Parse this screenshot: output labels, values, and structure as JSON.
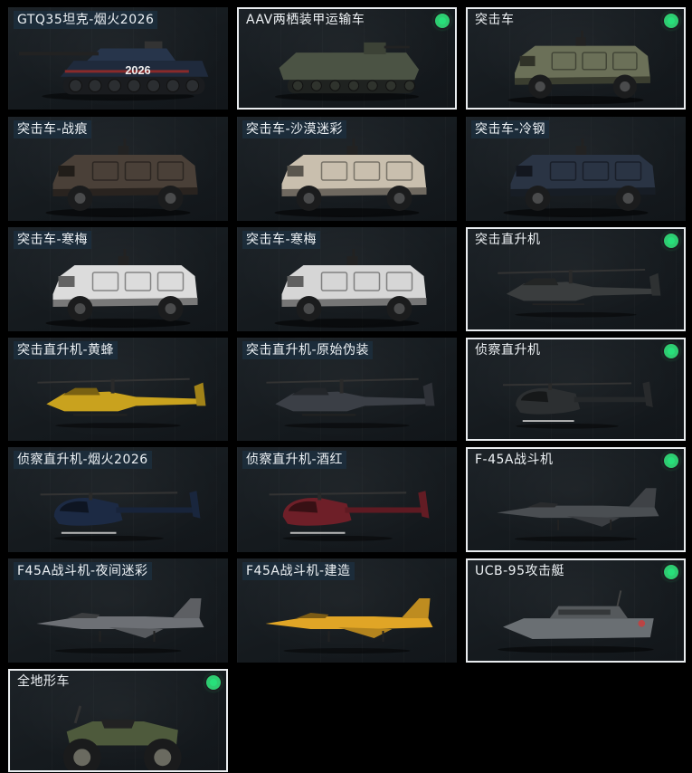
{
  "vehicles": [
    {
      "label": "GTQ35坦克-烟火2026",
      "icon": "tank-icon",
      "selected": false,
      "hull": "#1f2a3c",
      "trim": "#8a2a2a",
      "decal": "2026"
    },
    {
      "label": "AAV两栖装甲运输车",
      "icon": "amphibious-apc-icon",
      "selected": true,
      "hull": "#4b5344"
    },
    {
      "label": "突击车",
      "icon": "armored-car-icon",
      "selected": true,
      "hull": "#6b7058"
    },
    {
      "label": "突击车-战痕",
      "icon": "armored-car-icon",
      "selected": false,
      "hull": "#4a4038"
    },
    {
      "label": "突击车-沙漠迷彩",
      "icon": "armored-car-icon",
      "selected": false,
      "hull": "#c9bfae"
    },
    {
      "label": "突击车-冷钢",
      "icon": "armored-car-icon",
      "selected": false,
      "hull": "#2a3444"
    },
    {
      "label": "突击车-寒梅",
      "icon": "armored-car-icon",
      "selected": false,
      "hull": "#dcdcdc"
    },
    {
      "label": "突击车-寒梅",
      "icon": "armored-car-icon",
      "selected": false,
      "hull": "#d6d6d6"
    },
    {
      "label": "突击直升机",
      "icon": "attack-helicopter-icon",
      "selected": true,
      "hull": "#3a3d3e"
    },
    {
      "label": "突击直升机-黄蜂",
      "icon": "attack-helicopter-icon",
      "selected": false,
      "hull": "#c9a21e"
    },
    {
      "label": "突击直升机-原始伪装",
      "icon": "attack-helicopter-icon",
      "selected": false,
      "hull": "#3b3f46"
    },
    {
      "label": "侦察直升机",
      "icon": "scout-helicopter-icon",
      "selected": true,
      "hull": "#2c2f31"
    },
    {
      "label": "侦察直升机-烟火2026",
      "icon": "scout-helicopter-icon",
      "selected": false,
      "hull": "#1c2a44"
    },
    {
      "label": "侦察直升机-酒红",
      "icon": "scout-helicopter-icon",
      "selected": false,
      "hull": "#6e1f28"
    },
    {
      "label": "F-45A战斗机",
      "icon": "fighter-jet-icon",
      "selected": true,
      "hull": "#4a4e52"
    },
    {
      "label": "F45A战斗机-夜间迷彩",
      "icon": "fighter-jet-icon",
      "selected": false,
      "hull": "#6d7075"
    },
    {
      "label": "F45A战斗机-建造",
      "icon": "fighter-jet-icon",
      "selected": false,
      "hull": "#e0a526"
    },
    {
      "label": "UCB-95攻击艇",
      "icon": "attack-boat-icon",
      "selected": true,
      "hull": "#6a6f73"
    },
    {
      "label": "全地形车",
      "icon": "atv-icon",
      "selected": true,
      "hull": "#4e5a3c"
    }
  ]
}
